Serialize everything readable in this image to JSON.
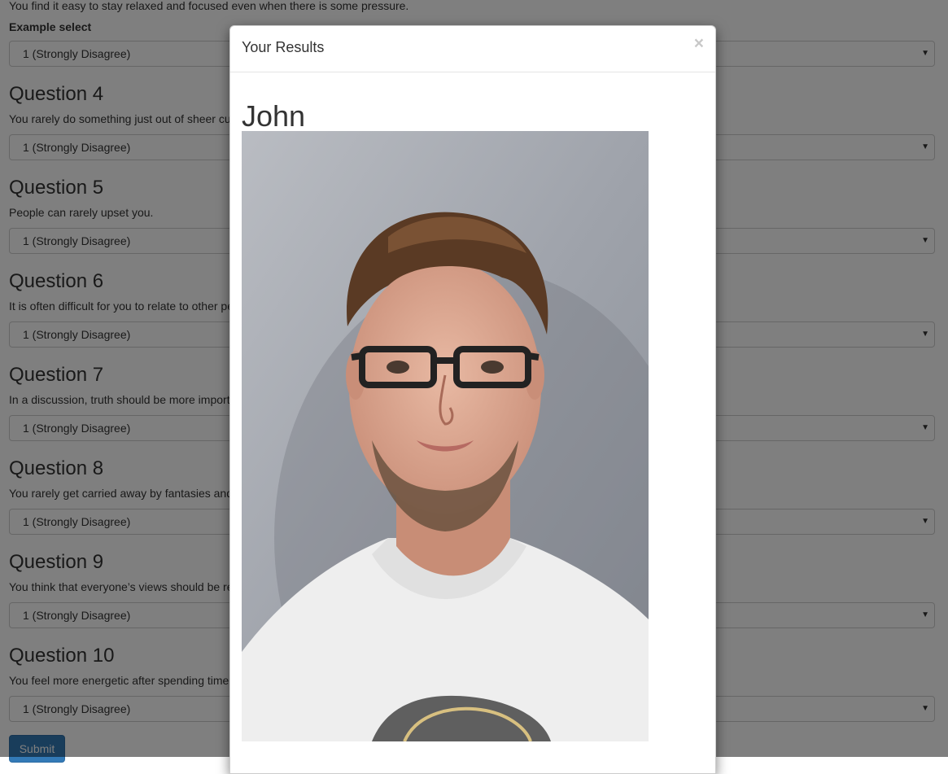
{
  "form": {
    "intro_text": "You find it easy to stay relaxed and focused even when there is some pressure.",
    "example_label": "Example select",
    "select_value": "1 (Strongly Disagree)",
    "questions": [
      {
        "title": "Question 4",
        "text": "You rarely do something just out of sheer cu"
      },
      {
        "title": "Question 5",
        "text": "People can rarely upset you."
      },
      {
        "title": "Question 6",
        "text": "It is often difficult for you to relate to other pe"
      },
      {
        "title": "Question 7",
        "text": "In a discussion, truth should be more import"
      },
      {
        "title": "Question 8",
        "text": "You rarely get carried away by fantasies and"
      },
      {
        "title": "Question 9",
        "text": "You think that everyone’s views should be re"
      },
      {
        "title": "Question 10",
        "text": "You feel more energetic after spending time"
      }
    ],
    "submit_label": "Submit"
  },
  "modal": {
    "title": "Your Results",
    "close_symbol": "×",
    "result_name": "John"
  },
  "icons": {
    "select_arrow": "dropdown-arrow-icon",
    "close": "close-icon"
  },
  "colors": {
    "primary_button": "#337ab7",
    "backdrop": "rgba(0,0,0,0.5)"
  }
}
